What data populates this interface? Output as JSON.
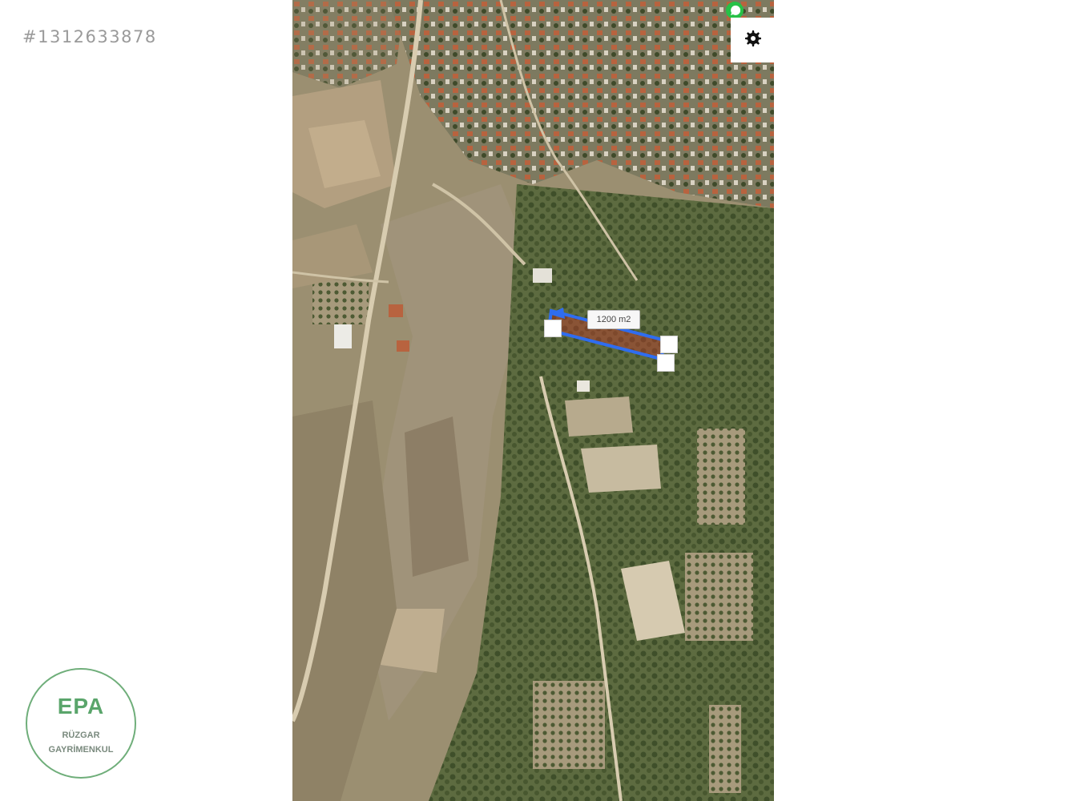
{
  "listing": {
    "id_text": "#1312633878"
  },
  "map": {
    "view": "satellite",
    "area_label": "1200 m2",
    "parcel_color": "#2f6df0",
    "parcel_fill": "#c0392b"
  },
  "controls": {
    "settings_icon": "gear-icon",
    "whatsapp_icon": "whatsapp-icon"
  },
  "logo": {
    "mark": "EPA",
    "tagline": "",
    "line1": "RÜZGAR",
    "line2": "GAYRİMENKUL",
    "color": "#5aa56b"
  }
}
